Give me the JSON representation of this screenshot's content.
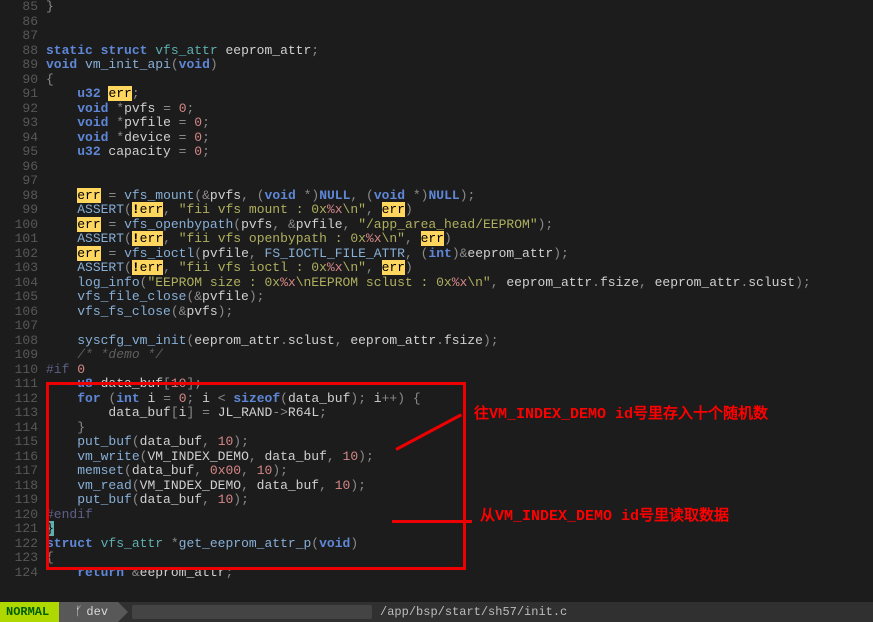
{
  "chart_data": null,
  "status": {
    "mode": "NORMAL",
    "branch_icon": "ᚶ",
    "branch": "dev",
    "path": "/app/bsp/start/sh57/init.c"
  },
  "annotations": {
    "top": "往VM_INDEX_DEMO id号里存入十个随机数",
    "bottom": "从VM_INDEX_DEMO id号里读取数据"
  },
  "lines": [
    {
      "n": "85",
      "tok": [
        [
          "op",
          "}"
        ]
      ]
    },
    {
      "n": "86",
      "tok": []
    },
    {
      "n": "87",
      "tok": []
    },
    {
      "n": "88",
      "tok": [
        [
          "kw",
          "static"
        ],
        [
          "id",
          " "
        ],
        [
          "kw",
          "struct"
        ],
        [
          "id",
          " "
        ],
        [
          "type",
          "vfs_attr"
        ],
        [
          "id",
          " eeprom_attr"
        ],
        [
          "op",
          ";"
        ]
      ]
    },
    {
      "n": "89",
      "tok": [
        [
          "kw",
          "void"
        ],
        [
          "id",
          " "
        ],
        [
          "fn",
          "vm_init_api"
        ],
        [
          "op",
          "("
        ],
        [
          "kw",
          "void"
        ],
        [
          "op",
          ")"
        ]
      ]
    },
    {
      "n": "90",
      "tok": [
        [
          "op",
          "{"
        ]
      ]
    },
    {
      "n": "91",
      "tok": [
        [
          "id",
          "    "
        ],
        [
          "kw",
          "u32"
        ],
        [
          "id",
          " "
        ],
        [
          "hlkw",
          "err"
        ],
        [
          "op",
          ";"
        ]
      ]
    },
    {
      "n": "92",
      "tok": [
        [
          "id",
          "    "
        ],
        [
          "kw",
          "void"
        ],
        [
          "id",
          " "
        ],
        [
          "op",
          "*"
        ],
        [
          "id",
          "pvfs "
        ],
        [
          "op",
          "="
        ],
        [
          "id",
          " "
        ],
        [
          "num",
          "0"
        ],
        [
          "op",
          ";"
        ]
      ]
    },
    {
      "n": "93",
      "tok": [
        [
          "id",
          "    "
        ],
        [
          "kw",
          "void"
        ],
        [
          "id",
          " "
        ],
        [
          "op",
          "*"
        ],
        [
          "id",
          "pvfile "
        ],
        [
          "op",
          "="
        ],
        [
          "id",
          " "
        ],
        [
          "num",
          "0"
        ],
        [
          "op",
          ";"
        ]
      ]
    },
    {
      "n": "94",
      "tok": [
        [
          "id",
          "    "
        ],
        [
          "kw",
          "void"
        ],
        [
          "id",
          " "
        ],
        [
          "op",
          "*"
        ],
        [
          "id",
          "device "
        ],
        [
          "op",
          "="
        ],
        [
          "id",
          " "
        ],
        [
          "num",
          "0"
        ],
        [
          "op",
          ";"
        ]
      ]
    },
    {
      "n": "95",
      "tok": [
        [
          "id",
          "    "
        ],
        [
          "kw",
          "u32"
        ],
        [
          "id",
          " capacity "
        ],
        [
          "op",
          "="
        ],
        [
          "id",
          " "
        ],
        [
          "num",
          "0"
        ],
        [
          "op",
          ";"
        ]
      ]
    },
    {
      "n": "96",
      "tok": []
    },
    {
      "n": "97",
      "tok": []
    },
    {
      "n": "98",
      "tok": [
        [
          "id",
          "    "
        ],
        [
          "hlkw",
          "err"
        ],
        [
          "id",
          " "
        ],
        [
          "op",
          "="
        ],
        [
          "id",
          " "
        ],
        [
          "fn",
          "vfs_mount"
        ],
        [
          "op",
          "(&"
        ],
        [
          "id",
          "pvfs"
        ],
        [
          "op",
          ","
        ],
        [
          "id",
          " "
        ],
        [
          "op",
          "("
        ],
        [
          "kw",
          "void"
        ],
        [
          "id",
          " "
        ],
        [
          "op",
          "*)"
        ],
        [
          "kw",
          "NULL"
        ],
        [
          "op",
          ","
        ],
        [
          "id",
          " "
        ],
        [
          "op",
          "("
        ],
        [
          "kw",
          "void"
        ],
        [
          "id",
          " "
        ],
        [
          "op",
          "*)"
        ],
        [
          "kw",
          "NULL"
        ],
        [
          "op",
          ");"
        ]
      ]
    },
    {
      "n": "99",
      "tok": [
        [
          "id",
          "    "
        ],
        [
          "fn",
          "ASSERT"
        ],
        [
          "op",
          "("
        ],
        [
          "hlbang",
          "!"
        ],
        [
          "hlkw",
          "err"
        ],
        [
          "op",
          ","
        ],
        [
          "id",
          " "
        ],
        [
          "str",
          "\"fii vfs mount : 0x"
        ],
        [
          "num",
          "%x"
        ],
        [
          "str",
          "\\n\""
        ],
        [
          "op",
          ","
        ],
        [
          "id",
          " "
        ],
        [
          "hlkw",
          "err"
        ],
        [
          "op",
          ")"
        ]
      ]
    },
    {
      "n": "100",
      "tok": [
        [
          "id",
          "    "
        ],
        [
          "hlkw",
          "err"
        ],
        [
          "id",
          " "
        ],
        [
          "op",
          "="
        ],
        [
          "id",
          " "
        ],
        [
          "fn",
          "vfs_openbypath"
        ],
        [
          "op",
          "("
        ],
        [
          "id",
          "pvfs"
        ],
        [
          "op",
          ","
        ],
        [
          "id",
          " "
        ],
        [
          "op",
          "&"
        ],
        [
          "id",
          "pvfile"
        ],
        [
          "op",
          ","
        ],
        [
          "id",
          " "
        ],
        [
          "str",
          "\"/app_area_head/EEPROM\""
        ],
        [
          "op",
          ");"
        ]
      ]
    },
    {
      "n": "101",
      "tok": [
        [
          "id",
          "    "
        ],
        [
          "fn",
          "ASSERT"
        ],
        [
          "op",
          "("
        ],
        [
          "hlbang",
          "!"
        ],
        [
          "hlkw",
          "err"
        ],
        [
          "op",
          ","
        ],
        [
          "id",
          " "
        ],
        [
          "str",
          "\"fii vfs openbypath : 0x"
        ],
        [
          "num",
          "%x"
        ],
        [
          "str",
          "\\n\""
        ],
        [
          "op",
          ","
        ],
        [
          "id",
          " "
        ],
        [
          "hlkw",
          "err"
        ],
        [
          "op",
          ")"
        ]
      ]
    },
    {
      "n": "102",
      "tok": [
        [
          "id",
          "    "
        ],
        [
          "hlkw",
          "err"
        ],
        [
          "id",
          " "
        ],
        [
          "op",
          "="
        ],
        [
          "id",
          " "
        ],
        [
          "fn",
          "vfs_ioctl"
        ],
        [
          "op",
          "("
        ],
        [
          "id",
          "pvfile"
        ],
        [
          "op",
          ","
        ],
        [
          "id",
          " "
        ],
        [
          "fn",
          "FS_IOCTL_FILE_ATTR"
        ],
        [
          "op",
          ","
        ],
        [
          "id",
          " "
        ],
        [
          "op",
          "("
        ],
        [
          "kw",
          "int"
        ],
        [
          "op",
          ")&"
        ],
        [
          "id",
          "eeprom_attr"
        ],
        [
          "op",
          ");"
        ]
      ]
    },
    {
      "n": "103",
      "tok": [
        [
          "id",
          "    "
        ],
        [
          "fn",
          "ASSERT"
        ],
        [
          "op",
          "("
        ],
        [
          "hlbang",
          "!"
        ],
        [
          "hlkw",
          "err"
        ],
        [
          "op",
          ","
        ],
        [
          "id",
          " "
        ],
        [
          "str",
          "\"fii vfs ioctl : 0x"
        ],
        [
          "num",
          "%x"
        ],
        [
          "str",
          "\\n\""
        ],
        [
          "op",
          ","
        ],
        [
          "id",
          " "
        ],
        [
          "hlkw",
          "err"
        ],
        [
          "op",
          ")"
        ]
      ]
    },
    {
      "n": "104",
      "tok": [
        [
          "id",
          "    "
        ],
        [
          "fn",
          "log_info"
        ],
        [
          "op",
          "("
        ],
        [
          "str",
          "\"EEPROM size : 0x"
        ],
        [
          "num",
          "%x"
        ],
        [
          "str",
          "\\nEEPROM sclust : 0x"
        ],
        [
          "num",
          "%x"
        ],
        [
          "str",
          "\\n\""
        ],
        [
          "op",
          ","
        ],
        [
          "id",
          " eeprom_attr"
        ],
        [
          "op",
          "."
        ],
        [
          "id",
          "fsize"
        ],
        [
          "op",
          ","
        ],
        [
          "id",
          " eeprom_attr"
        ],
        [
          "op",
          "."
        ],
        [
          "id",
          "sclust"
        ],
        [
          "op",
          ");"
        ]
      ]
    },
    {
      "n": "105",
      "tok": [
        [
          "id",
          "    "
        ],
        [
          "fn",
          "vfs_file_close"
        ],
        [
          "op",
          "(&"
        ],
        [
          "id",
          "pvfile"
        ],
        [
          "op",
          ");"
        ]
      ]
    },
    {
      "n": "106",
      "tok": [
        [
          "id",
          "    "
        ],
        [
          "fn",
          "vfs_fs_close"
        ],
        [
          "op",
          "(&"
        ],
        [
          "id",
          "pvfs"
        ],
        [
          "op",
          ");"
        ]
      ]
    },
    {
      "n": "107",
      "tok": []
    },
    {
      "n": "108",
      "tok": [
        [
          "id",
          "    "
        ],
        [
          "fn",
          "syscfg_vm_init"
        ],
        [
          "op",
          "("
        ],
        [
          "id",
          "eeprom_attr"
        ],
        [
          "op",
          "."
        ],
        [
          "id",
          "sclust"
        ],
        [
          "op",
          ","
        ],
        [
          "id",
          " eeprom_attr"
        ],
        [
          "op",
          "."
        ],
        [
          "id",
          "fsize"
        ],
        [
          "op",
          ");"
        ]
      ]
    },
    {
      "n": "109",
      "tok": [
        [
          "id",
          "    "
        ],
        [
          "cmt",
          "/* *demo */"
        ]
      ]
    },
    {
      "n": "110",
      "tok": [
        [
          "macro",
          "#if "
        ],
        [
          "num",
          "0"
        ]
      ]
    },
    {
      "n": "111",
      "tok": [
        [
          "id",
          "    "
        ],
        [
          "kw",
          "u8"
        ],
        [
          "id",
          " data_buf"
        ],
        [
          "op",
          "["
        ],
        [
          "num",
          "10"
        ],
        [
          "op",
          "];"
        ]
      ]
    },
    {
      "n": "112",
      "tok": [
        [
          "id",
          "    "
        ],
        [
          "kw",
          "for"
        ],
        [
          "id",
          " "
        ],
        [
          "op",
          "("
        ],
        [
          "kw",
          "int"
        ],
        [
          "id",
          " i "
        ],
        [
          "op",
          "="
        ],
        [
          "id",
          " "
        ],
        [
          "num",
          "0"
        ],
        [
          "op",
          ";"
        ],
        [
          "id",
          " i "
        ],
        [
          "op",
          "<"
        ],
        [
          "id",
          " "
        ],
        [
          "kw",
          "sizeof"
        ],
        [
          "op",
          "("
        ],
        [
          "id",
          "data_buf"
        ],
        [
          "op",
          ");"
        ],
        [
          "id",
          " i"
        ],
        [
          "op",
          "++) {"
        ]
      ]
    },
    {
      "n": "113",
      "tok": [
        [
          "id",
          "        data_buf"
        ],
        [
          "op",
          "["
        ],
        [
          "id",
          "i"
        ],
        [
          "op",
          "]"
        ],
        [
          "id",
          " "
        ],
        [
          "op",
          "="
        ],
        [
          "id",
          " JL_RAND"
        ],
        [
          "op",
          "->"
        ],
        [
          "id",
          "R64L"
        ],
        [
          "op",
          ";"
        ]
      ]
    },
    {
      "n": "114",
      "tok": [
        [
          "id",
          "    "
        ],
        [
          "op",
          "}"
        ]
      ]
    },
    {
      "n": "115",
      "tok": [
        [
          "id",
          "    "
        ],
        [
          "fn",
          "put_buf"
        ],
        [
          "op",
          "("
        ],
        [
          "id",
          "data_buf"
        ],
        [
          "op",
          ","
        ],
        [
          "id",
          " "
        ],
        [
          "num",
          "10"
        ],
        [
          "op",
          ");"
        ]
      ]
    },
    {
      "n": "116",
      "tok": [
        [
          "id",
          "    "
        ],
        [
          "fn",
          "vm_write"
        ],
        [
          "op",
          "("
        ],
        [
          "id",
          "VM_INDEX_DEMO"
        ],
        [
          "op",
          ","
        ],
        [
          "id",
          " data_buf"
        ],
        [
          "op",
          ","
        ],
        [
          "id",
          " "
        ],
        [
          "num",
          "10"
        ],
        [
          "op",
          ");"
        ]
      ]
    },
    {
      "n": "117",
      "tok": [
        [
          "id",
          "    "
        ],
        [
          "fn",
          "memset"
        ],
        [
          "op",
          "("
        ],
        [
          "id",
          "data_buf"
        ],
        [
          "op",
          ","
        ],
        [
          "id",
          " "
        ],
        [
          "num",
          "0x00"
        ],
        [
          "op",
          ","
        ],
        [
          "id",
          " "
        ],
        [
          "num",
          "10"
        ],
        [
          "op",
          ");"
        ]
      ]
    },
    {
      "n": "118",
      "tok": [
        [
          "id",
          "    "
        ],
        [
          "fn",
          "vm_read"
        ],
        [
          "op",
          "("
        ],
        [
          "id",
          "VM_INDEX_DEMO"
        ],
        [
          "op",
          ","
        ],
        [
          "id",
          " data_buf"
        ],
        [
          "op",
          ","
        ],
        [
          "id",
          " "
        ],
        [
          "num",
          "10"
        ],
        [
          "op",
          ");"
        ]
      ]
    },
    {
      "n": "119",
      "tok": [
        [
          "id",
          "    "
        ],
        [
          "fn",
          "put_buf"
        ],
        [
          "op",
          "("
        ],
        [
          "id",
          "data_buf"
        ],
        [
          "op",
          ","
        ],
        [
          "id",
          " "
        ],
        [
          "num",
          "10"
        ],
        [
          "op",
          ");"
        ]
      ]
    },
    {
      "n": "120",
      "tok": [
        [
          "macro",
          "#endif"
        ]
      ]
    },
    {
      "n": "121",
      "tok": [
        [
          "brace",
          "}"
        ]
      ]
    },
    {
      "n": "122",
      "tok": [
        [
          "kw",
          "struct"
        ],
        [
          "id",
          " "
        ],
        [
          "type",
          "vfs_attr"
        ],
        [
          "id",
          " "
        ],
        [
          "op",
          "*"
        ],
        [
          "fn",
          "get_eeprom_attr_p"
        ],
        [
          "op",
          "("
        ],
        [
          "kw",
          "void"
        ],
        [
          "op",
          ")"
        ]
      ]
    },
    {
      "n": "123",
      "tok": [
        [
          "op",
          "{"
        ]
      ]
    },
    {
      "n": "124",
      "tok": [
        [
          "id",
          "    "
        ],
        [
          "kw",
          "return"
        ],
        [
          "id",
          " "
        ],
        [
          "op",
          "&"
        ],
        [
          "id",
          "eeprom_attr"
        ],
        [
          "op",
          ";"
        ]
      ]
    }
  ]
}
